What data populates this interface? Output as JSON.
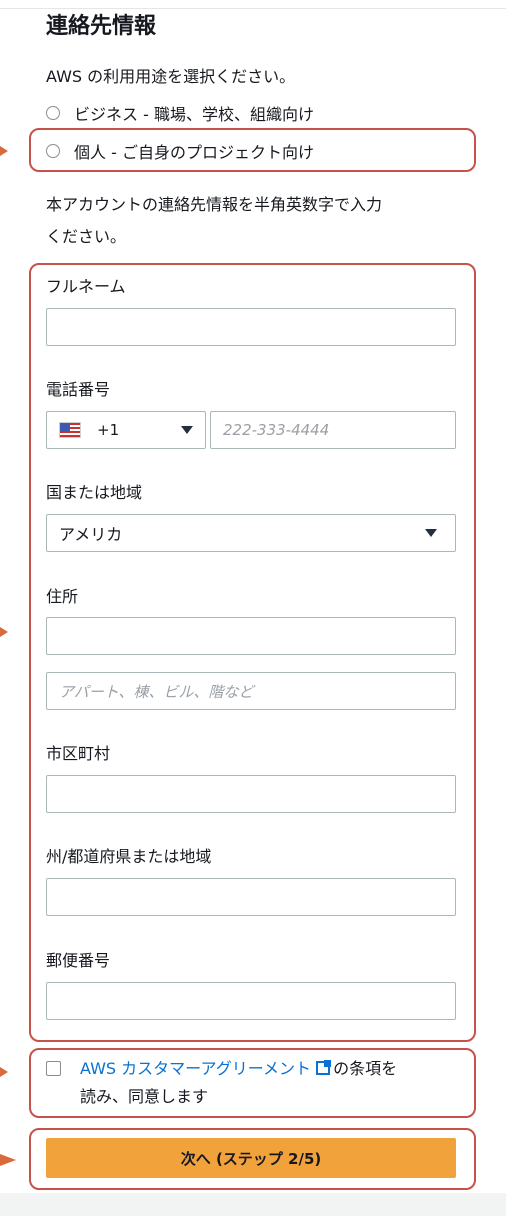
{
  "section": {
    "title": "連絡先情報",
    "usage_prompt": "AWS の利用用途を選択ください。",
    "usage_options": [
      "ビジネス - 職場、学校、組織向け",
      "個人 - ご自身のプロジェクト向け"
    ],
    "instruction_line1": "本アカウントの連絡先情報を半角英数字で入力",
    "instruction_line2": "ください。"
  },
  "form": {
    "full_name_label": "フルネーム",
    "full_name_value": "",
    "phone_label": "電話番号",
    "phone_country_code": "+1",
    "phone_placeholder": "222-333-4444",
    "country_label": "国または地域",
    "country_value": "アメリカ",
    "address_label": "住所",
    "address_line2_placeholder": "アパート、棟、ビル、階など",
    "city_label": "市区町村",
    "state_label": "州/都道府県または地域",
    "postal_label": "郵便番号"
  },
  "agreement": {
    "link_text": "AWS カスタマーアグリーメント",
    "suffix": "の条項を",
    "line2": "読み、同意します"
  },
  "next_button_label": "次へ (ステップ 2/5)",
  "colors": {
    "annotation": "#c7524a",
    "primary_button": "#f2a23a",
    "link": "#0972d3"
  }
}
